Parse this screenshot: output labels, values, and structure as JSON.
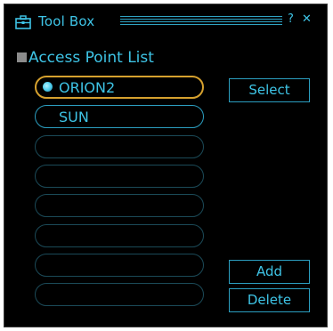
{
  "window": {
    "title": "Tool Box",
    "help_label": "?",
    "close_label": "✕"
  },
  "section": {
    "label": "Access Point List"
  },
  "access_points": [
    {
      "name": "ORION2",
      "selected": true,
      "connected": true
    },
    {
      "name": "SUN",
      "selected": false,
      "connected": false
    },
    {
      "name": "",
      "selected": false,
      "connected": false
    },
    {
      "name": "",
      "selected": false,
      "connected": false
    },
    {
      "name": "",
      "selected": false,
      "connected": false
    },
    {
      "name": "",
      "selected": false,
      "connected": false
    },
    {
      "name": "",
      "selected": false,
      "connected": false
    },
    {
      "name": "",
      "selected": false,
      "connected": false
    }
  ],
  "buttons": {
    "select": "Select",
    "add": "Add",
    "delete": "Delete"
  },
  "colors": {
    "background": "#000000",
    "accent": "#3ec4e6",
    "selection_border": "#d6a12e",
    "icon_gray": "#8c8c8c"
  },
  "icons": {
    "title": "toolbox-icon",
    "section": "square-bullet-icon",
    "connected": "connected-dot-icon"
  }
}
